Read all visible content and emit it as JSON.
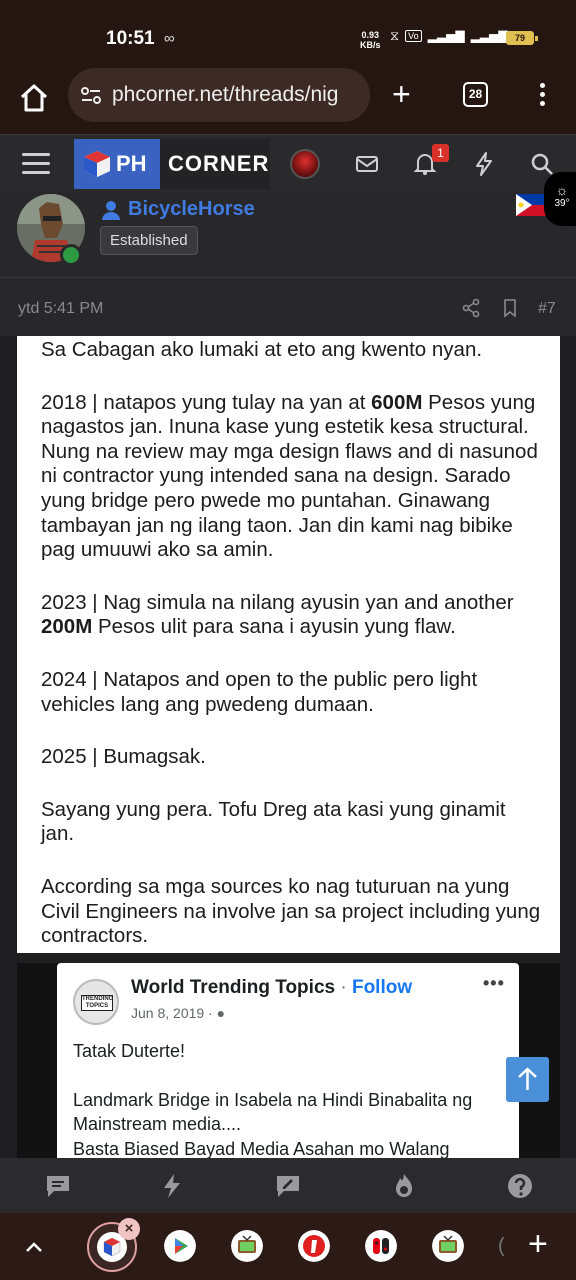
{
  "status_bar": {
    "time": "10:51",
    "net_speed_value": "0.93",
    "net_speed_unit": "KB/s",
    "battery": "79"
  },
  "browser": {
    "url": "phcorner.net/threads/nig",
    "tab_count": "28"
  },
  "forum": {
    "logo_ph": "PH",
    "logo_corner": "CORNER",
    "notification_count": "1"
  },
  "post": {
    "username": "BicycleHorse",
    "user_badge": "Established",
    "time": "ytd 5:41 PM",
    "number": "#7",
    "weather_temp": "39°",
    "paragraphs": {
      "p1": "Sa Cabagan ako lumaki at eto ang kwento nyan.",
      "p2_pre": "2018 | natapos yung tulay na yan at ",
      "p2_bold": "600M",
      "p2_post": " Pesos yung nagastos jan. Inuna kase yung estetik kesa structural. Nung na review may mga design flaws and di nasunod ni contractor yung intended sana na design. Sarado yung bridge pero pwede mo puntahan. Ginawang tambayan jan ng ilang taon. Jan din kami nag bibike pag umuuwi ako sa amin.",
      "p3_pre": "2023 | Nag simula na nilang ayusin yan and another ",
      "p3_bold": "200M",
      "p3_post": " Pesos ulit para sana i ayusin yung flaw.",
      "p4": "2024 |  Natapos and open to the public pero light vehicles lang ang pwedeng dumaan.",
      "p5": "2025 | Bumagsak.",
      "p6": "Sayang yung pera. Tofu Dreg ata kasi yung ginamit jan.",
      "p7": "According sa mga sources ko nag tuturuan na yung Civil Engineers na involve jan sa project including yung contractors."
    }
  },
  "embed": {
    "page_name": "World Trending Topics",
    "separator": " · ",
    "follow": "Follow",
    "date": "Jun 8, 2019 · ",
    "avatar_text_1": "TRENDING",
    "avatar_text_2": "TOPICS",
    "line1": "Tatak Duterte!",
    "line2": "Landmark Bridge in Isabela na Hindi Binabalita ng Mainstream media....",
    "line3": "Basta Biased Bayad Media  Asahan mo Walang"
  }
}
